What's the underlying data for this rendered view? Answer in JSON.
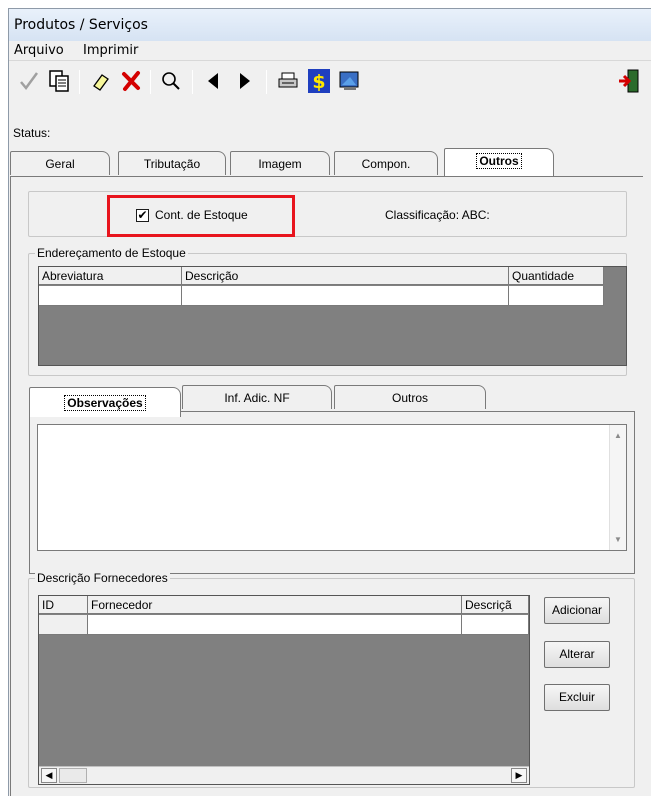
{
  "window": {
    "title": "Produtos / Serviços"
  },
  "menu": {
    "items": [
      "Arquivo",
      "Imprimir"
    ]
  },
  "toolbar": {
    "icons": [
      "confirm-check-icon",
      "copy-icon",
      "eraser-icon",
      "delete-x-icon",
      "search-magnifier-icon",
      "previous-arrow-icon",
      "next-arrow-icon",
      "printer-icon",
      "dollar-icon",
      "monitor-image-icon",
      "exit-door-icon"
    ]
  },
  "status": {
    "label": "Status:"
  },
  "tabs": {
    "main": [
      "Geral",
      "Tributação",
      "Imagem",
      "Compon.",
      "Outros"
    ],
    "active": "Outros"
  },
  "stock": {
    "checkbox_label": "Cont. de Estoque",
    "checkbox_checked": true,
    "classification_label": "Classificação: ABC:"
  },
  "addressing": {
    "title": "Endereçamento de Estoque",
    "columns": [
      "Abreviatura",
      "Descrição",
      "Quantidade"
    ]
  },
  "notes": {
    "tabs": [
      "Observações",
      "Inf. Adic. NF",
      "Outros"
    ],
    "active": "Observações",
    "text": ""
  },
  "suppliers": {
    "title": "Descrição Fornecedores",
    "columns": [
      "ID",
      "Fornecedor",
      "Descriçã"
    ],
    "buttons": {
      "add": "Adicionar",
      "edit": "Alterar",
      "delete": "Excluir"
    }
  },
  "colors": {
    "highlight": "#e8141d",
    "grid_empty": "#808080"
  }
}
